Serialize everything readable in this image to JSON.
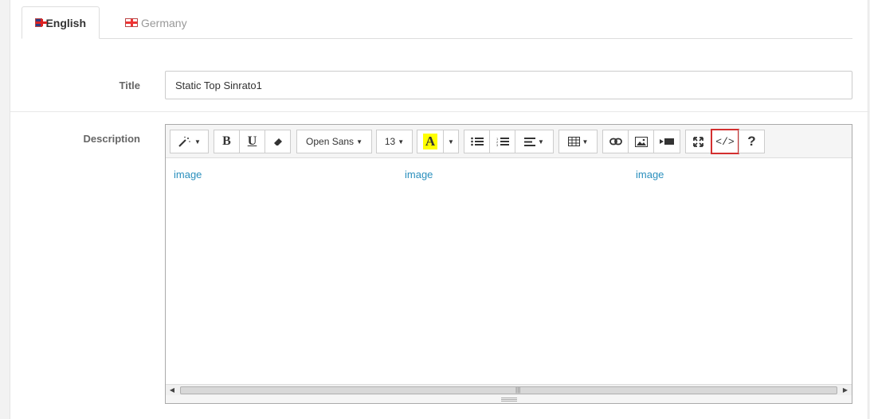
{
  "tabs": [
    {
      "label": "English",
      "flag": "uk-flag-icon",
      "active": true
    },
    {
      "label": "Germany",
      "flag": "ge-flag-icon",
      "active": false
    }
  ],
  "form": {
    "title_label": "Title",
    "title_value": "Static Top Sinrato1",
    "description_label": "Description"
  },
  "toolbar": {
    "font_name": "Open Sans",
    "font_size": "13",
    "color_letter": "A",
    "codeview_label": "</>",
    "help_label": "?",
    "highlight_color": "#ffff00",
    "active_border_color": "#d32f2f"
  },
  "content": {
    "links": [
      "image",
      "image",
      "image"
    ]
  }
}
